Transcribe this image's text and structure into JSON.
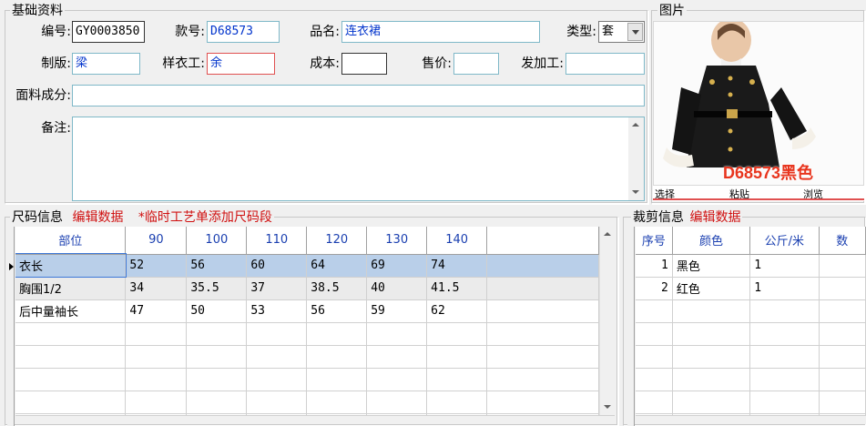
{
  "basic": {
    "legend": "基础资料",
    "labels": {
      "code": "编号:",
      "style": "款号:",
      "name": "品名:",
      "type": "类型:",
      "pattern": "制版:",
      "sample": "样衣工:",
      "cost": "成本:",
      "price": "售价:",
      "processor": "发加工:",
      "fabric": "面料成分:",
      "remark": "备注:"
    },
    "values": {
      "code": "GY0003850",
      "style": "D68573",
      "name": "连衣裙",
      "type": "套",
      "pattern": "梁",
      "sample": "余",
      "cost": "",
      "price": "",
      "processor": "",
      "fabric": "",
      "remark": ""
    }
  },
  "photo": {
    "legend": "图片",
    "caption": "D68573黑色",
    "buttons": {
      "select": "选择",
      "paste": "粘贴",
      "browse": "浏览"
    }
  },
  "size": {
    "legend": "尺码信息",
    "edit": "编辑数据",
    "note": "*临时工艺单添加尺码段",
    "columns": [
      "部位",
      "90",
      "100",
      "110",
      "120",
      "130",
      "140"
    ],
    "rows": [
      [
        "衣长",
        "52",
        "56",
        "60",
        "64",
        "69",
        "74"
      ],
      [
        "胸围1/2",
        "34",
        "35.5",
        "37",
        "38.5",
        "40",
        "41.5"
      ],
      [
        "后中量袖长",
        "47",
        "50",
        "53",
        "56",
        "59",
        "62"
      ]
    ]
  },
  "cut": {
    "legend": "裁剪信息",
    "edit": "编辑数据",
    "columns": [
      "序号",
      "颜色",
      "公斤/米",
      "数"
    ],
    "rows": [
      [
        "1",
        "黑色",
        "1",
        ""
      ],
      [
        "2",
        "红色",
        "1",
        ""
      ]
    ]
  }
}
